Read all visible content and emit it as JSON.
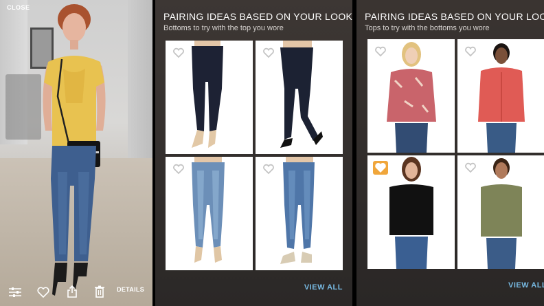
{
  "look": {
    "close_label": "CLOSE",
    "details_label": "DETAILS",
    "toolbar_icons": [
      "sliders-icon",
      "heart-icon",
      "share-icon",
      "trash-icon"
    ]
  },
  "bottoms_panel": {
    "title": "PAIRING IDEAS BASED ON YOUR LOOK",
    "subtitle": "Bottoms to try with the top you wore",
    "view_all_label": "VIEW ALL",
    "items": [
      {
        "kind": "dark skinny jeans with beige heels",
        "favorited": false
      },
      {
        "kind": "dark skinny jeans with black flats",
        "favorited": false
      },
      {
        "kind": "light wash skinny jeans with heels",
        "favorited": false
      },
      {
        "kind": "medium wash jeans with loafers",
        "favorited": false
      }
    ]
  },
  "tops_panel": {
    "title": "PAIRING IDEAS BASED ON YOUR LOOK",
    "subtitle": "Tops to try with the bottoms you wore",
    "view_all_label": "VIEW ALL",
    "items": [
      {
        "kind": "floral peasant blouse",
        "favorited": false
      },
      {
        "kind": "coral button shirt",
        "favorited": false
      },
      {
        "kind": "black tee",
        "favorited": true
      },
      {
        "kind": "olive bodysuit tee",
        "favorited": false
      }
    ]
  },
  "colors": {
    "heart_active": "#f0a63b",
    "link_blue": "#77b9e2"
  }
}
